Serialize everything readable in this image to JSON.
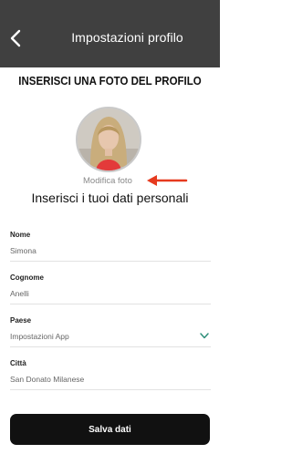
{
  "header": {
    "title": "Impostazioni profilo"
  },
  "profile": {
    "section_title": "INSERISCI UNA FOTO DEL PROFILO",
    "modify_photo": "Modifica foto",
    "personal_title": "Inserisci i tuoi dati personali"
  },
  "fields": [
    {
      "label": "Nome",
      "value": "Simona"
    },
    {
      "label": "Cognome",
      "value": "Anelli"
    },
    {
      "label": "Paese",
      "value": "Impostazioni App"
    },
    {
      "label": "Città",
      "value": "San Donato Milanese"
    }
  ],
  "save_button": "Salva dati",
  "colors": {
    "header": "#404040",
    "arrow": "#e63a1e",
    "chevron": "#2f8f7a",
    "button": "#111111"
  },
  "icons": {
    "back": "chevron-left-icon",
    "dropdown": "chevron-down-icon",
    "pointer": "arrow-left-icon"
  }
}
